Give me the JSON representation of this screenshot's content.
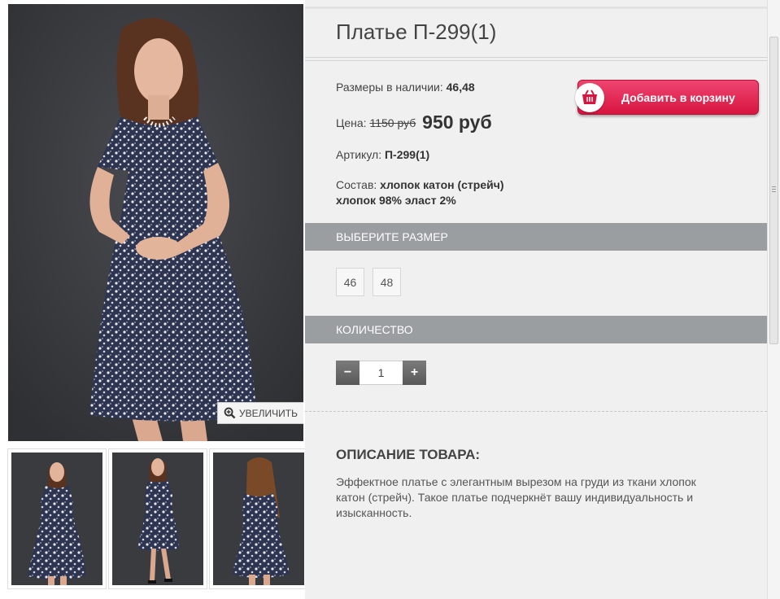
{
  "gallery": {
    "zoom_label": "УВЕЛИЧИТЬ",
    "main_image": "woman-in-floral-dress-photo",
    "thumbnails": [
      "front-view",
      "side-view",
      "back-view"
    ]
  },
  "product": {
    "title": "Платье П-299(1)",
    "sizes_label": "Размеры в наличии:",
    "sizes_value": "46,48",
    "price_label": "Цена:",
    "price_old": "1150 руб",
    "price_new": "950 руб",
    "article_label": "Артикул:",
    "article_value": "П-299(1)",
    "composition_label": "Состав:",
    "composition_line1": "хлопок катон (стрейч)",
    "composition_line2": "хлопок 98% эласт 2%"
  },
  "cart": {
    "label": "Добавить в корзину"
  },
  "size_section": {
    "heading": "ВЫБЕРИТЕ РАЗМЕР",
    "options": [
      "46",
      "48"
    ]
  },
  "quantity_section": {
    "heading": "КОЛИЧЕСТВО",
    "minus": "−",
    "plus": "+",
    "value": "1"
  },
  "description": {
    "heading": "ОПИСАНИЕ ТОВАРА:",
    "text": "Эффектное платье с элегантным вырезом на груди из ткани хлопок катон (стрейч). Такое платье подчеркнёт вашу индивидуальность и изысканность."
  },
  "colors": {
    "accent": "#e0204d",
    "section_bar": "#9a9ea1",
    "panel_bg": "#f0f0f0"
  }
}
